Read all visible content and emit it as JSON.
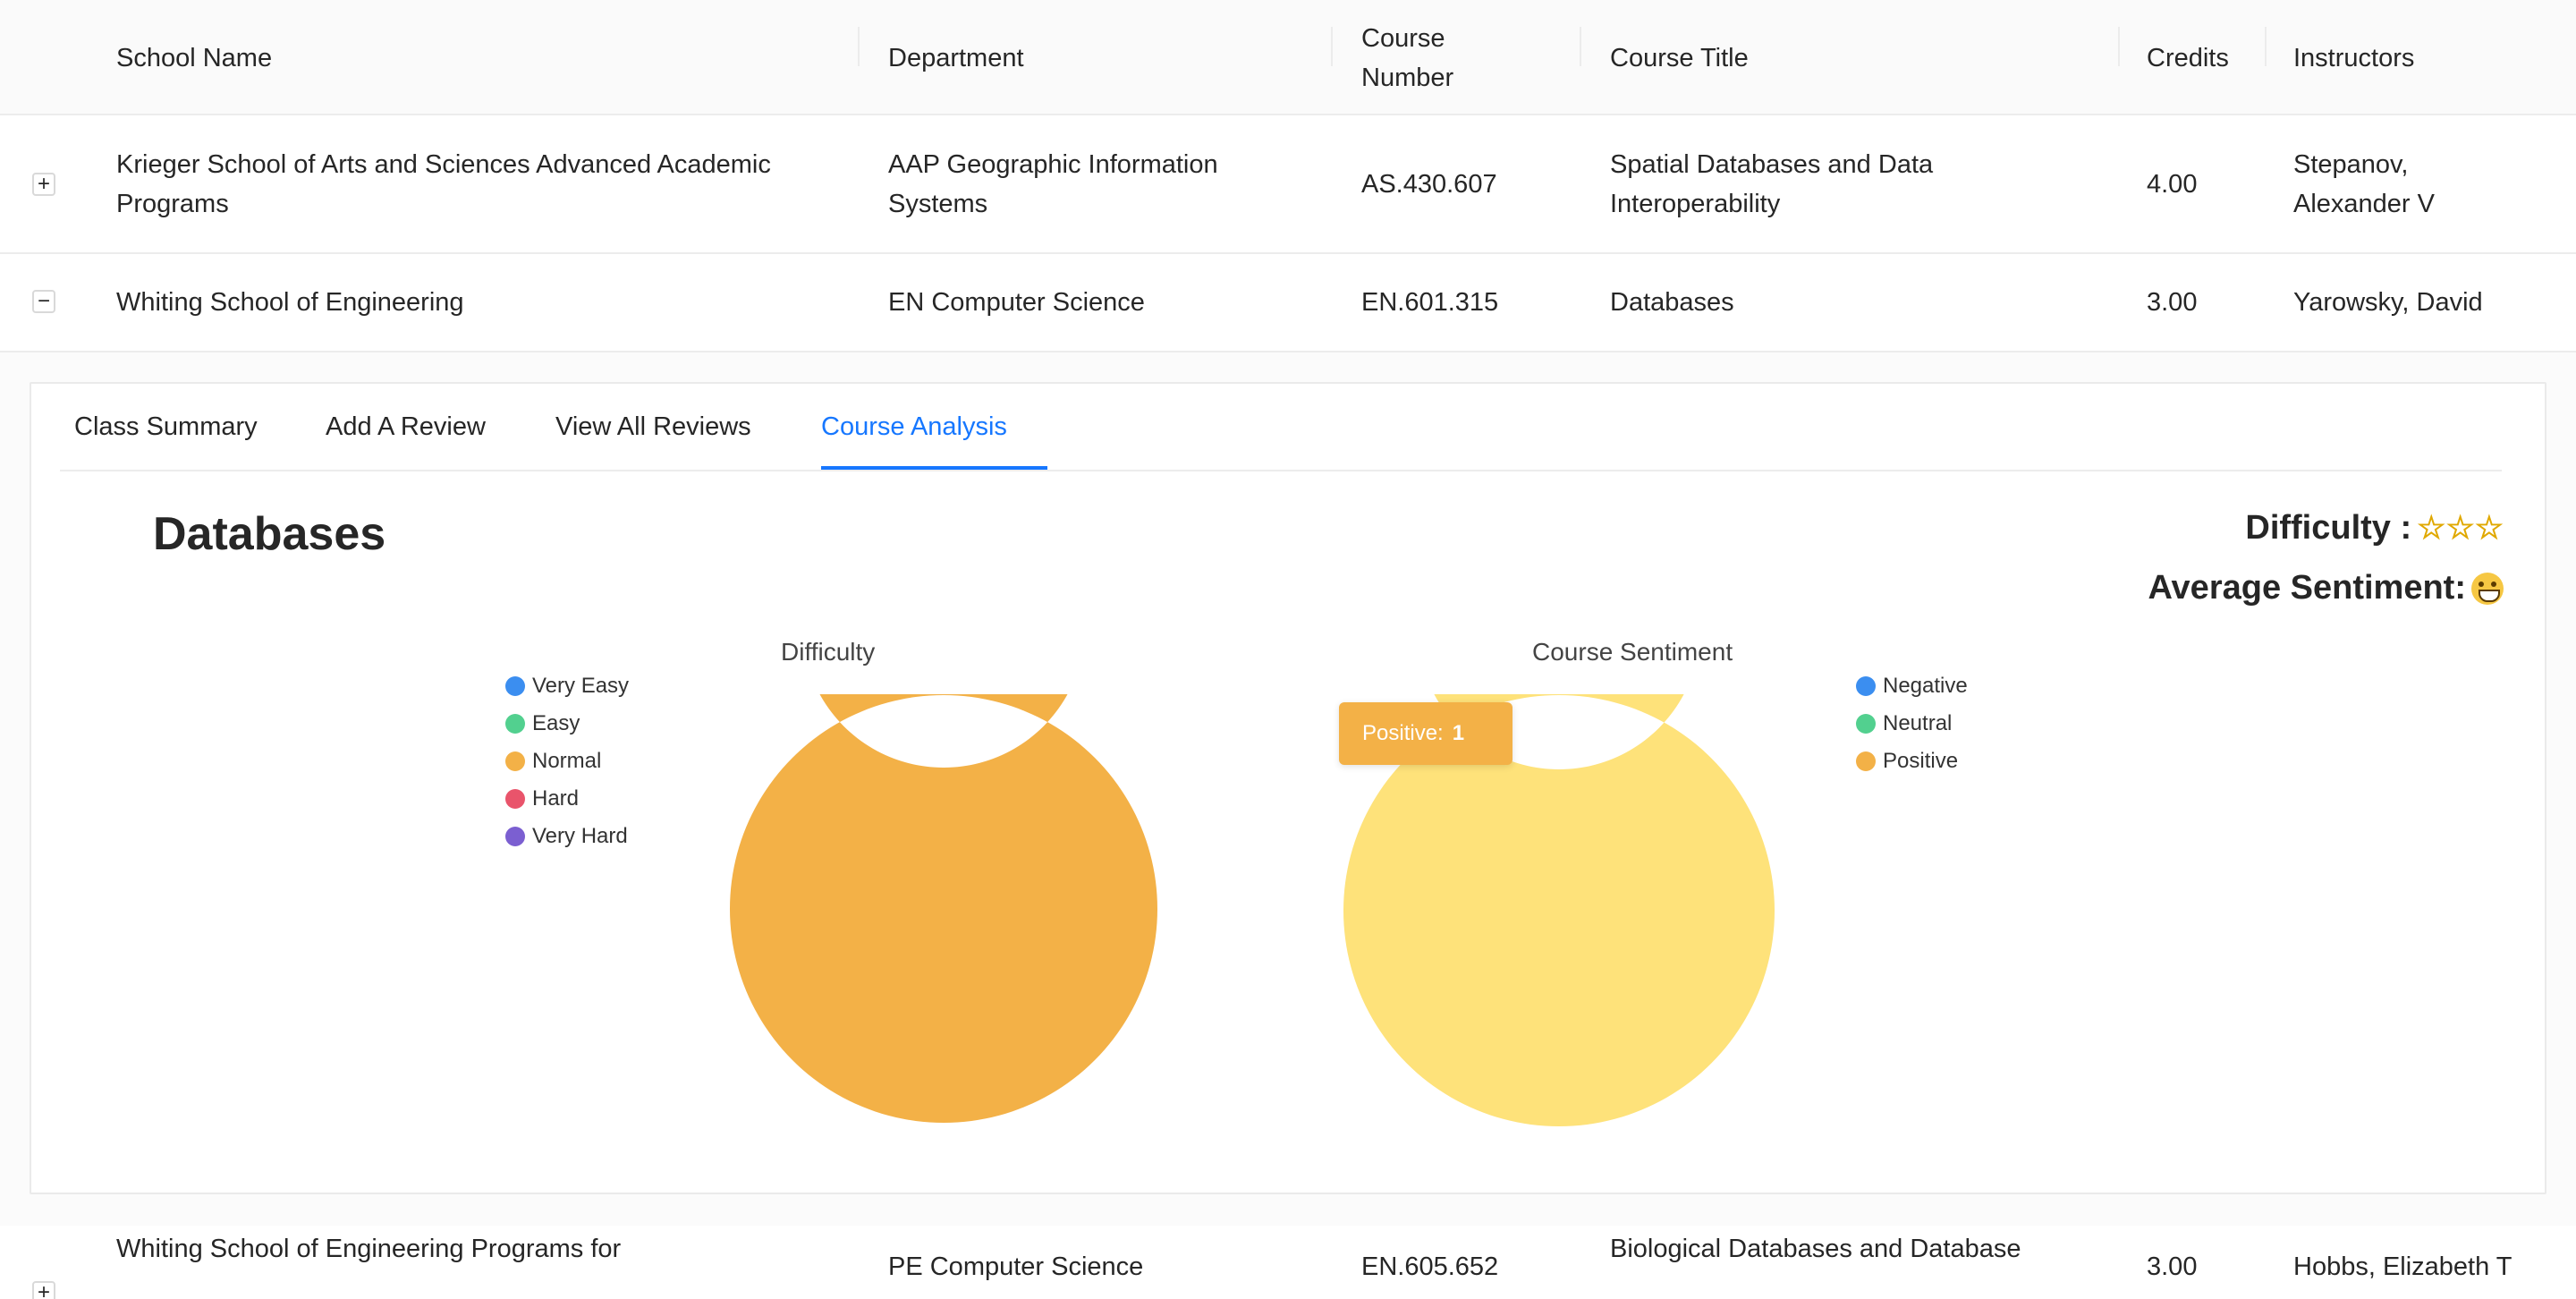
{
  "table": {
    "headers": {
      "school": "School Name",
      "department": "Department",
      "course_number_line1": "Course",
      "course_number_line2": "Number",
      "course_title": "Course Title",
      "credits": "Credits",
      "instructors": "Instructors"
    },
    "rows": [
      {
        "expand": "+",
        "school_line1": "Krieger School of Arts and Sciences Advanced Academic",
        "school_line2": "Programs",
        "department_line1": "AAP Geographic Information",
        "department_line2": "Systems",
        "course_number": "AS.430.607",
        "course_title_line1": "Spatial Databases and Data",
        "course_title_line2": "Interoperability",
        "credits": "4.00",
        "instructors_line1": "Stepanov,",
        "instructors_line2": "Alexander V"
      },
      {
        "expand": "−",
        "school": "Whiting School of Engineering",
        "department": "EN Computer Science",
        "course_number": "EN.601.315",
        "course_title": "Databases",
        "credits": "3.00",
        "instructors": "Yarowsky, David"
      },
      {
        "expand": "+",
        "school": "Whiting School of Engineering Programs for",
        "department": "PE Computer Science",
        "course_number": "EN.605.652",
        "course_title": "Biological Databases and Database",
        "credits": "3.00",
        "instructors": "Hobbs, Elizabeth T"
      }
    ]
  },
  "panel": {
    "tabs": [
      "Class Summary",
      "Add A Review",
      "View All Reviews",
      "Course Analysis"
    ],
    "active_tab": "Course Analysis",
    "course_name": "Databases",
    "difficulty_label": "Difficulty :",
    "difficulty_stars": 3,
    "sentiment_label": "Average Sentiment:",
    "sentiment_icon": "grinning-face-icon",
    "tooltip": {
      "label": "Positive:",
      "value": "1"
    }
  },
  "chart_data": [
    {
      "type": "pie",
      "variant": "donut",
      "title": "Difficulty",
      "categories": [
        "Very Easy",
        "Easy",
        "Normal",
        "Hard",
        "Very Hard"
      ],
      "values": [
        0,
        0,
        1,
        0,
        0
      ],
      "colors": [
        "#3b8ef0",
        "#52d08f",
        "#f3b147",
        "#e9546b",
        "#7b5fd1"
      ],
      "legend": "left"
    },
    {
      "type": "pie",
      "variant": "donut",
      "title": "Course Sentiment",
      "categories": [
        "Negative",
        "Neutral",
        "Positive"
      ],
      "values": [
        0,
        0,
        1
      ],
      "colors": [
        "#3b8ef0",
        "#52d08f",
        "#f3b147"
      ],
      "highlight_color": "#fee27a",
      "legend": "right"
    }
  ]
}
